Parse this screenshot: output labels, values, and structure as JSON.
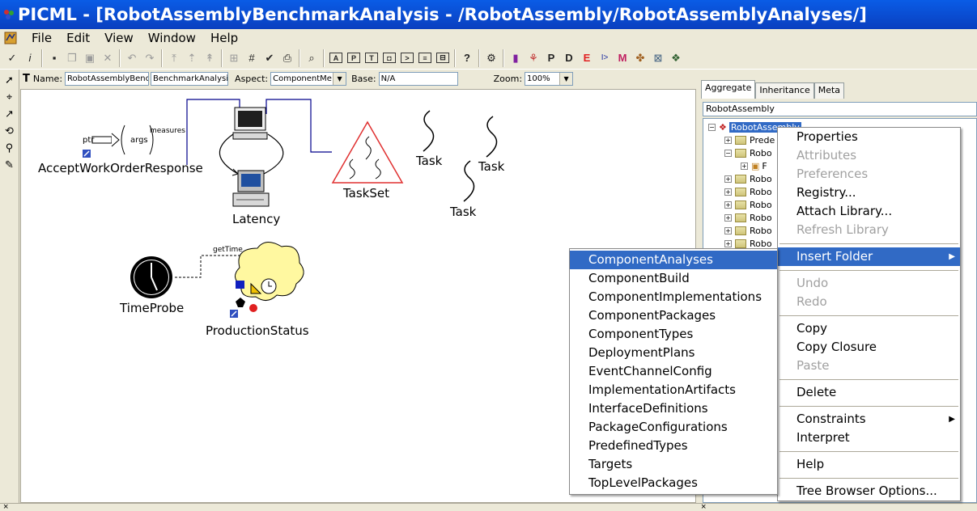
{
  "title_bar": {
    "text": "PICML - [RobotAssemblyBenchmarkAnalysis - /RobotAssembly/RobotAssemblyAnalyses/]"
  },
  "menu": [
    "File",
    "Edit",
    "View",
    "Window",
    "Help"
  ],
  "name_bar": {
    "name_label": "Name:",
    "name_value": "RobotAssemblyBenc",
    "name_value2": "BenchmarkAnalysis",
    "aspect_label": "Aspect:",
    "aspect_value": "ComponentMe",
    "base_label": "Base:",
    "base_value": "N/A",
    "zoom_label": "Zoom:",
    "zoom_value": "100%"
  },
  "canvas": {
    "labels": {
      "accept": "AcceptWorkOrderResponse",
      "ptr": "ptr",
      "args": "args",
      "measures": "measures",
      "latency": "Latency",
      "taskset": "TaskSet",
      "task1": "Task",
      "task2": "Task",
      "task3": "Task",
      "timeprobe": "TimeProbe",
      "gettime": "getTime",
      "production": "ProductionStatus"
    }
  },
  "right_panel": {
    "tabs": [
      "Aggregate",
      "Inheritance",
      "Meta"
    ],
    "root_field": "RobotAssembly",
    "tree": {
      "root": "RobotAssembly",
      "children": [
        "Prede",
        "Robo",
        "F",
        "Robo",
        "Robo",
        "Robo",
        "Robo",
        "Robo",
        "Robo"
      ]
    }
  },
  "context_menu": {
    "items": [
      {
        "label": "Properties",
        "disabled": false
      },
      {
        "label": "Attributes",
        "disabled": true
      },
      {
        "label": "Preferences",
        "disabled": true
      },
      {
        "label": "Registry...",
        "disabled": false
      },
      {
        "label": "Attach Library...",
        "disabled": false
      },
      {
        "label": "Refresh Library",
        "disabled": true
      },
      {
        "label": "Insert Folder",
        "disabled": false
      },
      {
        "label": "Undo",
        "disabled": true
      },
      {
        "label": "Redo",
        "disabled": true
      },
      {
        "label": "Copy",
        "disabled": false
      },
      {
        "label": "Copy Closure",
        "disabled": false
      },
      {
        "label": "Paste",
        "disabled": true
      },
      {
        "label": "Delete",
        "disabled": false
      },
      {
        "label": "Constraints",
        "disabled": false
      },
      {
        "label": "Interpret",
        "disabled": false
      },
      {
        "label": "Help",
        "disabled": false
      },
      {
        "label": "Tree Browser Options...",
        "disabled": false
      }
    ]
  },
  "submenu": {
    "items": [
      "ComponentAnalyses",
      "ComponentBuild",
      "ComponentImplementations",
      "ComponentPackages",
      "ComponentTypes",
      "DeploymentPlans",
      "EventChannelConfig",
      "ImplementationArtifacts",
      "InterfaceDefinitions",
      "PackageConfigurations",
      "PredefinedTypes",
      "Targets",
      "TopLevelPackages"
    ],
    "selected": "ComponentAnalyses"
  },
  "colors": {
    "titlebar": "#0a4fd6",
    "highlight": "#316ac5",
    "connection": "#00008b",
    "taskset_triangle": "#e03030"
  }
}
